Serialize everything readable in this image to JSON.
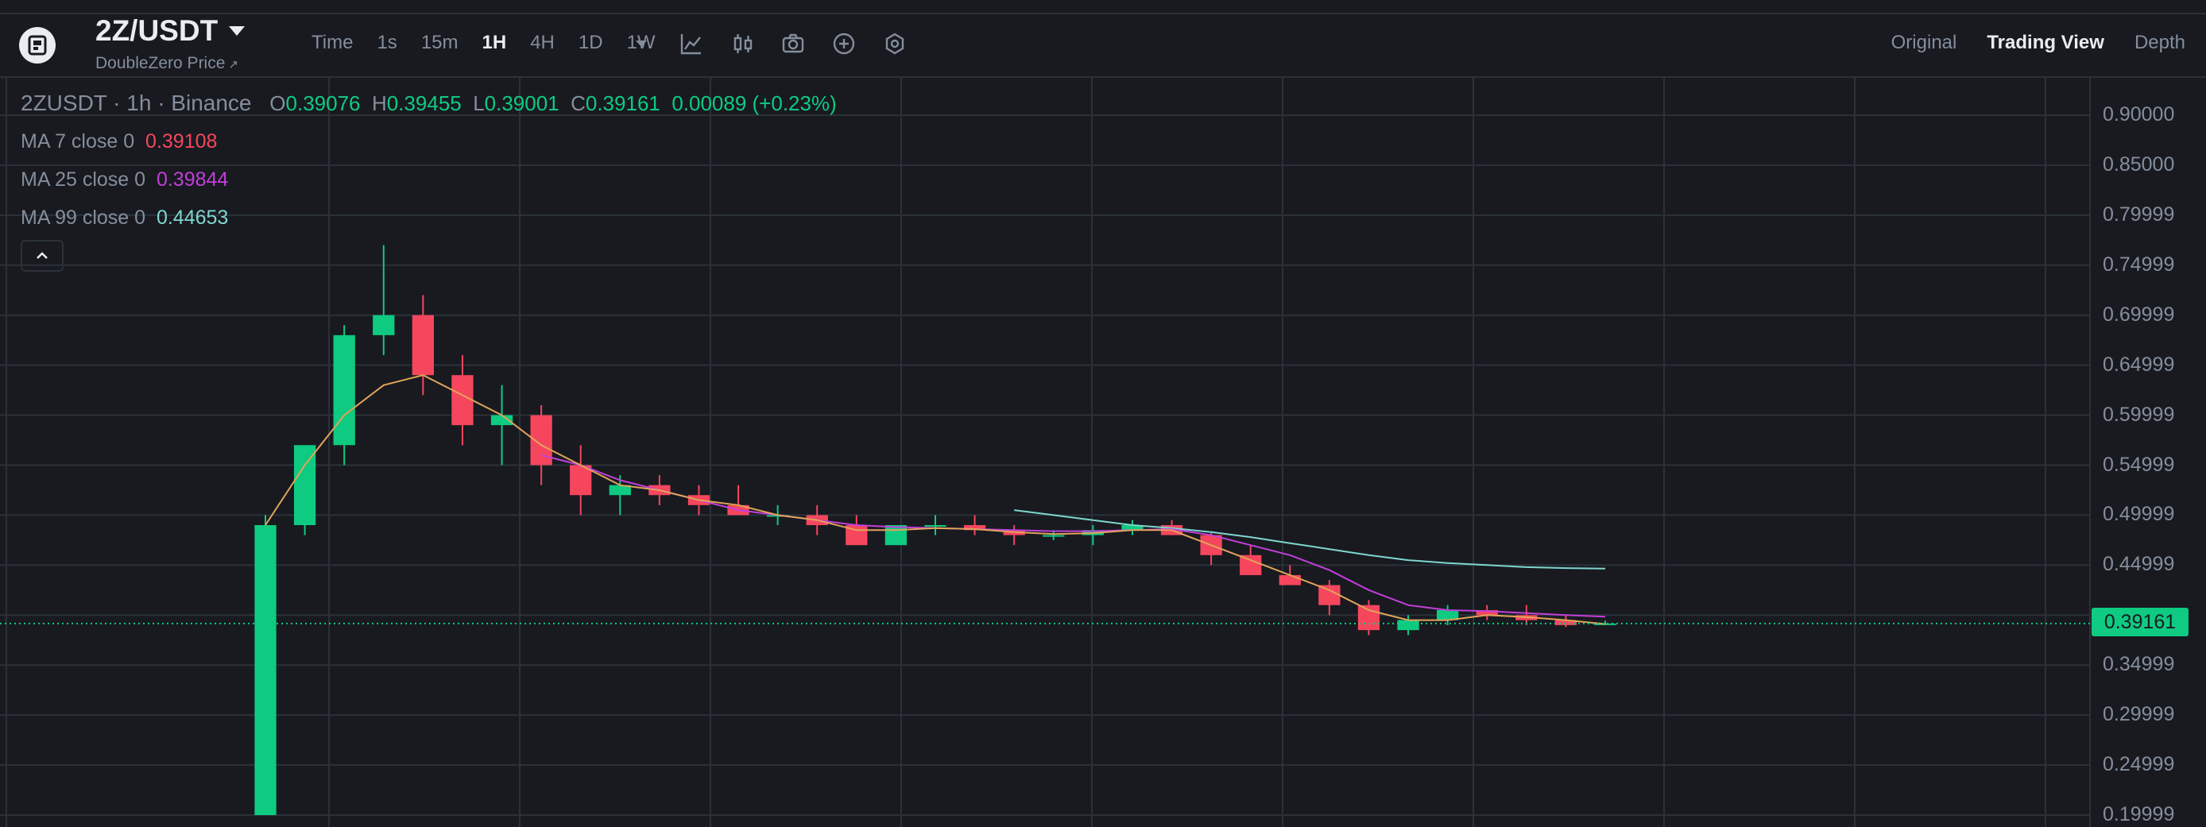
{
  "header": {
    "pair": "2Z/USDT",
    "subtitle": "DoubleZero Price",
    "subtitle_icon": "external-link-icon",
    "timeframes": [
      {
        "label": "Time",
        "active": false
      },
      {
        "label": "1s",
        "active": false
      },
      {
        "label": "15m",
        "active": false
      },
      {
        "label": "1H",
        "active": true
      },
      {
        "label": "4H",
        "active": false
      },
      {
        "label": "1D",
        "active": false
      },
      {
        "label": "1W",
        "active": false
      }
    ],
    "tool_icons": [
      "more-timeframes-caret-icon",
      "indicators-icon",
      "chart-type-icon",
      "screenshot-icon",
      "add-icon",
      "settings-icon"
    ],
    "views": [
      {
        "label": "Original",
        "active": false
      },
      {
        "label": "Trading View",
        "active": true
      },
      {
        "label": "Depth",
        "active": false
      }
    ]
  },
  "legend": {
    "symbol": "2ZUSDT · 1h · Binance",
    "o_label": "O",
    "o": "0.39076",
    "h_label": "H",
    "h": "0.39455",
    "l_label": "L",
    "l": "0.39001",
    "c_label": "C",
    "c": "0.39161",
    "change": "0.00089 (+0.23%)"
  },
  "moving_averages": [
    {
      "label": "MA 7 close 0",
      "value": "0.39108",
      "color": "#f6465d"
    },
    {
      "label": "MA 25 close 0",
      "value": "0.39844",
      "color": "#c23fd9"
    },
    {
      "label": "MA 99 close 0",
      "value": "0.44653",
      "color": "#7fd6cf"
    }
  ],
  "collapse_icon": "chevron-up-icon",
  "price_axis": [
    "0.90000",
    "0.85000",
    "0.79999",
    "0.74999",
    "0.69999",
    "0.64999",
    "0.59999",
    "0.54999",
    "0.49999",
    "0.44999",
    "0.39161",
    "0.34999",
    "0.29999",
    "0.24999",
    "0.19999"
  ],
  "current_price": "0.39161",
  "colors": {
    "up": "#0ecb81",
    "down": "#f6465d",
    "background": "#181a20",
    "grid": "#2b3139",
    "text_muted": "#848e9c",
    "text": "#eaecef"
  },
  "chart_data": {
    "type": "candlestick",
    "ylim": [
      0.19999,
      0.9
    ],
    "current_price": 0.39161,
    "series_ohlc_approx": [
      {
        "o": 0.2,
        "h": 0.5,
        "l": 0.2,
        "c": 0.49
      },
      {
        "o": 0.49,
        "h": 0.57,
        "l": 0.48,
        "c": 0.57
      },
      {
        "o": 0.57,
        "h": 0.69,
        "l": 0.55,
        "c": 0.68
      },
      {
        "o": 0.68,
        "h": 0.77,
        "l": 0.66,
        "c": 0.7
      },
      {
        "o": 0.7,
        "h": 0.72,
        "l": 0.62,
        "c": 0.64
      },
      {
        "o": 0.64,
        "h": 0.66,
        "l": 0.57,
        "c": 0.59
      },
      {
        "o": 0.59,
        "h": 0.63,
        "l": 0.55,
        "c": 0.6
      },
      {
        "o": 0.6,
        "h": 0.61,
        "l": 0.53,
        "c": 0.55
      },
      {
        "o": 0.55,
        "h": 0.57,
        "l": 0.5,
        "c": 0.52
      },
      {
        "o": 0.52,
        "h": 0.54,
        "l": 0.5,
        "c": 0.53
      },
      {
        "o": 0.53,
        "h": 0.54,
        "l": 0.51,
        "c": 0.52
      },
      {
        "o": 0.52,
        "h": 0.53,
        "l": 0.5,
        "c": 0.51
      },
      {
        "o": 0.51,
        "h": 0.53,
        "l": 0.5,
        "c": 0.5
      },
      {
        "o": 0.5,
        "h": 0.51,
        "l": 0.49,
        "c": 0.5
      },
      {
        "o": 0.5,
        "h": 0.51,
        "l": 0.48,
        "c": 0.49
      },
      {
        "o": 0.49,
        "h": 0.5,
        "l": 0.47,
        "c": 0.47
      },
      {
        "o": 0.47,
        "h": 0.49,
        "l": 0.47,
        "c": 0.49
      },
      {
        "o": 0.49,
        "h": 0.5,
        "l": 0.48,
        "c": 0.49
      },
      {
        "o": 0.49,
        "h": 0.5,
        "l": 0.48,
        "c": 0.485
      },
      {
        "o": 0.485,
        "h": 0.49,
        "l": 0.47,
        "c": 0.48
      },
      {
        "o": 0.48,
        "h": 0.485,
        "l": 0.475,
        "c": 0.48
      },
      {
        "o": 0.48,
        "h": 0.49,
        "l": 0.47,
        "c": 0.485
      },
      {
        "o": 0.485,
        "h": 0.495,
        "l": 0.48,
        "c": 0.49
      },
      {
        "o": 0.49,
        "h": 0.495,
        "l": 0.48,
        "c": 0.48
      },
      {
        "o": 0.48,
        "h": 0.482,
        "l": 0.45,
        "c": 0.46
      },
      {
        "o": 0.46,
        "h": 0.47,
        "l": 0.44,
        "c": 0.44
      },
      {
        "o": 0.44,
        "h": 0.45,
        "l": 0.43,
        "c": 0.43
      },
      {
        "o": 0.43,
        "h": 0.435,
        "l": 0.4,
        "c": 0.41
      },
      {
        "o": 0.41,
        "h": 0.415,
        "l": 0.38,
        "c": 0.385
      },
      {
        "o": 0.385,
        "h": 0.4,
        "l": 0.38,
        "c": 0.395
      },
      {
        "o": 0.395,
        "h": 0.41,
        "l": 0.39,
        "c": 0.405
      },
      {
        "o": 0.405,
        "h": 0.41,
        "l": 0.395,
        "c": 0.4
      },
      {
        "o": 0.4,
        "h": 0.41,
        "l": 0.39,
        "c": 0.395
      },
      {
        "o": 0.395,
        "h": 0.4,
        "l": 0.388,
        "c": 0.39
      },
      {
        "o": 0.39076,
        "h": 0.39455,
        "l": 0.39001,
        "c": 0.39161
      }
    ],
    "ma7_approx": [
      0.49,
      0.55,
      0.6,
      0.63,
      0.64,
      0.62,
      0.6,
      0.57,
      0.55,
      0.53,
      0.525,
      0.515,
      0.51,
      0.5,
      0.495,
      0.485,
      0.485,
      0.487,
      0.486,
      0.483,
      0.481,
      0.482,
      0.485,
      0.485,
      0.47,
      0.455,
      0.44,
      0.425,
      0.405,
      0.395,
      0.395,
      0.4,
      0.398,
      0.395,
      0.39108
    ],
    "ma25_approx": [
      null,
      null,
      null,
      null,
      null,
      null,
      null,
      0.56,
      0.55,
      0.535,
      0.525,
      0.515,
      0.505,
      0.5,
      0.495,
      0.49,
      0.488,
      0.487,
      0.486,
      0.485,
      0.484,
      0.484,
      0.485,
      0.486,
      0.48,
      0.47,
      0.46,
      0.445,
      0.425,
      0.41,
      0.405,
      0.404,
      0.402,
      0.4,
      0.39844
    ],
    "ma99_approx": [
      null,
      null,
      null,
      null,
      null,
      null,
      null,
      null,
      null,
      null,
      null,
      null,
      null,
      null,
      null,
      null,
      null,
      null,
      null,
      0.505,
      0.5,
      0.495,
      0.49,
      0.487,
      0.483,
      0.478,
      0.472,
      0.466,
      0.46,
      0.455,
      0.452,
      0.45,
      0.448,
      0.447,
      0.44653
    ]
  }
}
